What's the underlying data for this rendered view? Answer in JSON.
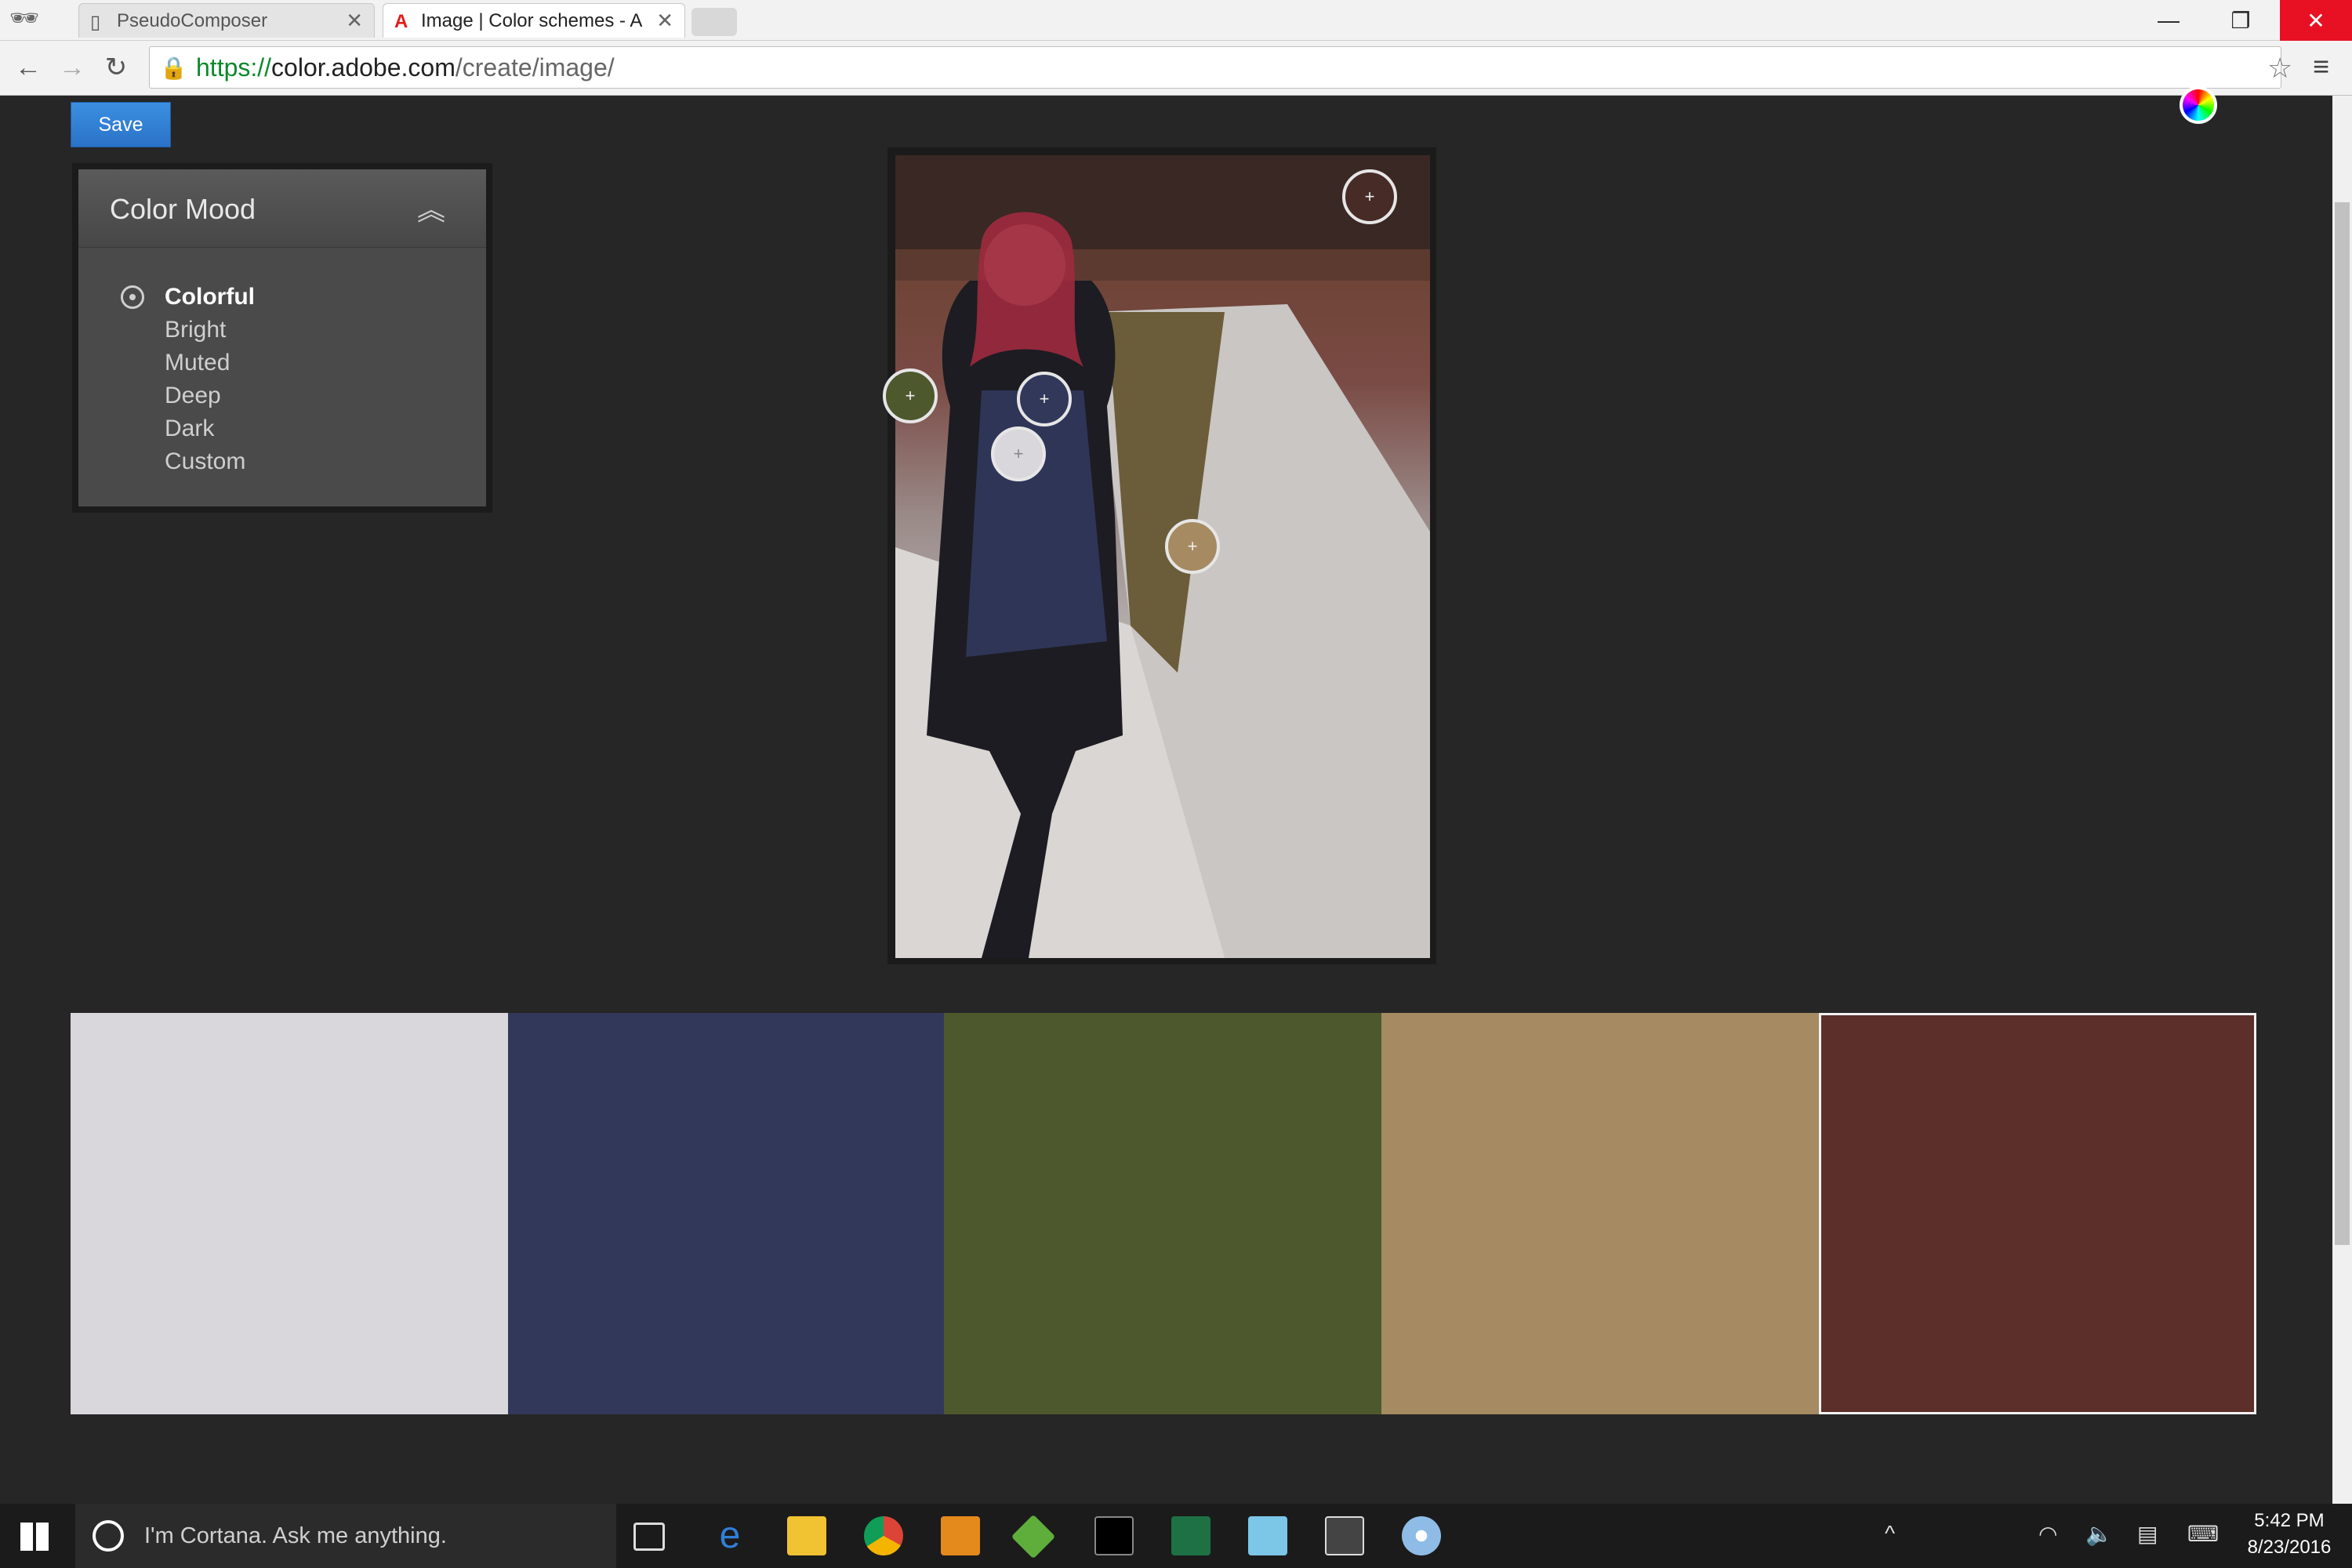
{
  "browser": {
    "tabs": [
      {
        "label": "PseudoComposer",
        "active": false
      },
      {
        "label": "Image | Color schemes - A",
        "active": true
      }
    ],
    "url_scheme": "https://",
    "url_host": "color.adobe.com",
    "url_path": "/create/image/"
  },
  "toolbar": {
    "save_label": "Save"
  },
  "color_mood": {
    "title": "Color Mood",
    "options": [
      "Colorful",
      "Bright",
      "Muted",
      "Deep",
      "Dark",
      "Custom"
    ],
    "selected": "Colorful"
  },
  "palette": {
    "swatches": [
      "#d9d7dc",
      "#32385a",
      "#4e582d",
      "#a68a61",
      "#5c2f2a"
    ],
    "selected_index": 4
  },
  "taskbar": {
    "search_placeholder": "I'm Cortana. Ask me anything.",
    "time": "5:42 PM",
    "date": "8/23/2016"
  }
}
